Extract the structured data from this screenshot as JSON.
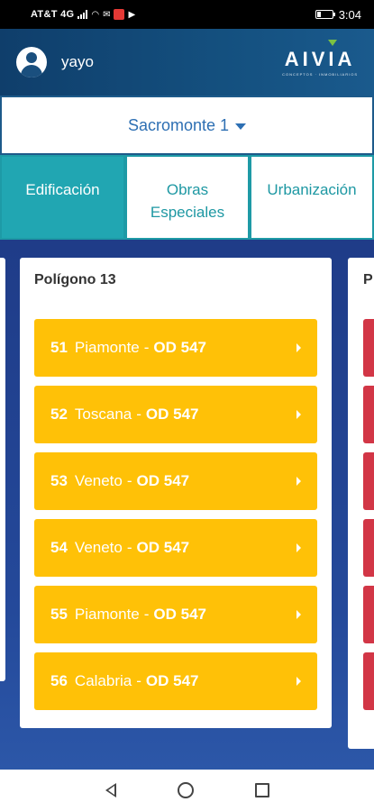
{
  "status_bar": {
    "carrier": "AT&T 4G",
    "time": "3:04",
    "battery_level": 0.3
  },
  "header": {
    "username": "yayo",
    "logo_text": "AIVIA",
    "logo_tagline": "CONCEPTOS · INMOBILIARIOS"
  },
  "project_selector": {
    "value": "Sacromonte 1"
  },
  "tabs": [
    {
      "label": "Edificación",
      "active": true
    },
    {
      "label": "Obras Especiales",
      "active": false
    },
    {
      "label": "Urbanización",
      "active": false
    }
  ],
  "card": {
    "title": "Polígono 13",
    "items": [
      {
        "num": "51",
        "name": "Piamonte",
        "sep": "-",
        "code": "OD 547"
      },
      {
        "num": "52",
        "name": "Toscana",
        "sep": "-",
        "code": "OD 547"
      },
      {
        "num": "53",
        "name": "Veneto",
        "sep": "-",
        "code": "OD 547"
      },
      {
        "num": "54",
        "name": "Veneto",
        "sep": "-",
        "code": "OD 547"
      },
      {
        "num": "55",
        "name": "Piamonte",
        "sep": "-",
        "code": "OD 547"
      },
      {
        "num": "56",
        "name": "Calabria",
        "sep": "-",
        "code": "OD 547"
      }
    ]
  },
  "next_card": {
    "title_fragment": "P"
  },
  "colors": {
    "header": "#14507f",
    "tab_active": "#21a6b2",
    "item_yellow": "#ffc107",
    "item_red": "#d23646",
    "main_bg": "#1f3c88"
  }
}
